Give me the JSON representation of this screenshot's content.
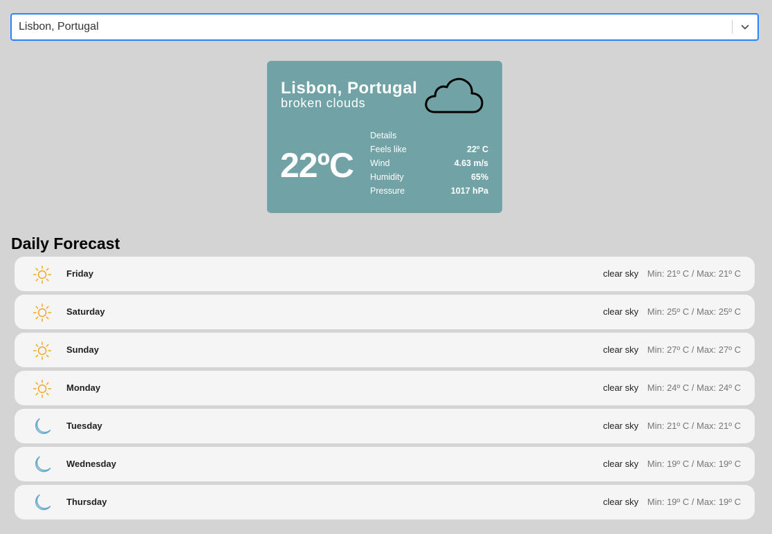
{
  "search": {
    "value": "Lisbon, Portugal"
  },
  "current": {
    "city": "Lisbon, Portugal",
    "description": "broken clouds",
    "icon": "cloud-icon",
    "temperature": "22ºC",
    "details_title": "Details",
    "details": [
      {
        "label": "Feels like",
        "value": "22º C"
      },
      {
        "label": "Wind",
        "value": "4.63 m/s"
      },
      {
        "label": "Humidity",
        "value": "65%"
      },
      {
        "label": "Pressure",
        "value": "1017 hPa"
      }
    ]
  },
  "forecast": {
    "title": "Daily Forecast",
    "days": [
      {
        "day": "Friday",
        "description": "clear sky",
        "minmax": "Min: 21º C / Max: 21º C",
        "icon": "sun-icon"
      },
      {
        "day": "Saturday",
        "description": "clear sky",
        "minmax": "Min: 25º C / Max: 25º C",
        "icon": "sun-icon"
      },
      {
        "day": "Sunday",
        "description": "clear sky",
        "minmax": "Min: 27º C / Max: 27º C",
        "icon": "sun-icon"
      },
      {
        "day": "Monday",
        "description": "clear sky",
        "minmax": "Min: 24º C / Max: 24º C",
        "icon": "sun-icon"
      },
      {
        "day": "Tuesday",
        "description": "clear sky",
        "minmax": "Min: 21º C / Max: 21º C",
        "icon": "moon-icon"
      },
      {
        "day": "Wednesday",
        "description": "clear sky",
        "minmax": "Min: 19º C / Max: 19º C",
        "icon": "moon-icon"
      },
      {
        "day": "Thursday",
        "description": "clear sky",
        "minmax": "Min: 19º C / Max: 19º C",
        "icon": "moon-icon"
      }
    ]
  },
  "colors": {
    "card_background": "#71a2a6",
    "page_background": "#d4d4d4",
    "focus_border": "#2684ff",
    "sun_icon": "#f5a623",
    "moon_icon": "#6aa9c9"
  }
}
